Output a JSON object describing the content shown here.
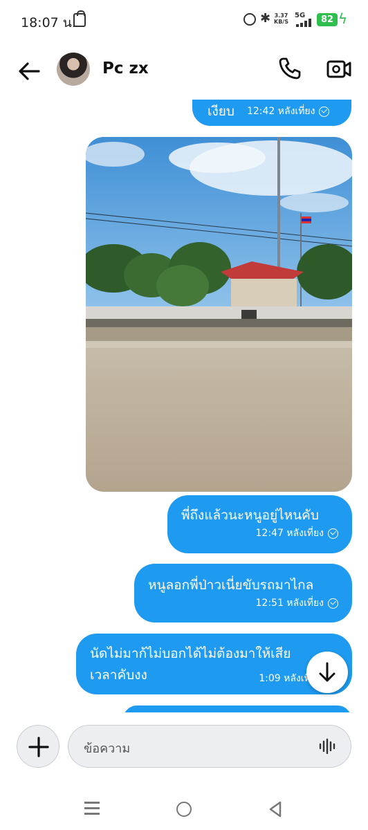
{
  "status_bar": {
    "time": "18:07 น.",
    "net_speed_value": "3.37",
    "net_speed_unit": "KB/S",
    "network": "5G",
    "battery": "82"
  },
  "header": {
    "contact_name": "Pc zx"
  },
  "messages": [
    {
      "text": "เงียบ",
      "time": "12:42 หลังเที่ยง"
    },
    {
      "type": "image",
      "description_icon": "photo-street-scene"
    },
    {
      "text": "พี่ถึงแล้วนะหนูอยู่ไหนคับ",
      "time": "12:47 หลังเที่ยง"
    },
    {
      "text": "หนูลอกพี่ป่าวเนี่ยขับรถมาไกล",
      "time": "12:51 หลังเที่ยง"
    },
    {
      "text_line1": "นัดไม่มาก้ไม่บอกได้ไม่ต้องมาให้เสีย",
      "text_line2": "เวลาคับงง",
      "time": "1:09 หลังเที่ย"
    }
  ],
  "composer": {
    "placeholder": "ข้อความ"
  },
  "colors": {
    "bubble": "#1e9bf0",
    "battery": "#2fbf4f"
  }
}
